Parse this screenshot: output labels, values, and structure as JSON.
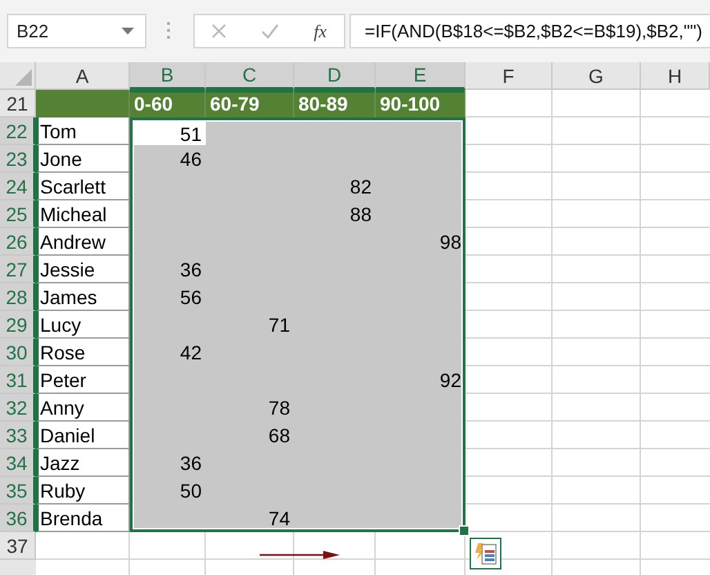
{
  "name_box": {
    "value": "B22"
  },
  "formula_bar": {
    "function_label": "fx",
    "formula": "=IF(AND(B$18<=$B2,$B2<=B$19),$B2,\"\")"
  },
  "columns": [
    {
      "label": "A",
      "selected": false
    },
    {
      "label": "B",
      "selected": true
    },
    {
      "label": "C",
      "selected": true
    },
    {
      "label": "D",
      "selected": true
    },
    {
      "label": "E",
      "selected": true
    },
    {
      "label": "F",
      "selected": false
    },
    {
      "label": "G",
      "selected": false
    },
    {
      "label": "H",
      "selected": false
    }
  ],
  "rows": [
    {
      "label": "21",
      "kind": "header",
      "selected": false,
      "cells": [
        null,
        "0-60",
        "60-79",
        "80-89",
        "90-100"
      ]
    },
    {
      "label": "22",
      "kind": "data",
      "selected": true,
      "cells": [
        "Tom",
        "51",
        null,
        null,
        null
      ]
    },
    {
      "label": "23",
      "kind": "data",
      "selected": true,
      "cells": [
        "Jone",
        "46",
        null,
        null,
        null
      ]
    },
    {
      "label": "24",
      "kind": "data",
      "selected": true,
      "cells": [
        "Scarlett",
        null,
        null,
        "82",
        null
      ]
    },
    {
      "label": "25",
      "kind": "data",
      "selected": true,
      "cells": [
        "Micheal",
        null,
        null,
        "88",
        null
      ]
    },
    {
      "label": "26",
      "kind": "data",
      "selected": true,
      "cells": [
        "Andrew",
        null,
        null,
        null,
        "98"
      ]
    },
    {
      "label": "27",
      "kind": "data",
      "selected": true,
      "cells": [
        "Jessie",
        "36",
        null,
        null,
        null
      ]
    },
    {
      "label": "28",
      "kind": "data",
      "selected": true,
      "cells": [
        "James",
        "56",
        null,
        null,
        null
      ]
    },
    {
      "label": "29",
      "kind": "data",
      "selected": true,
      "cells": [
        "Lucy",
        null,
        "71",
        null,
        null
      ]
    },
    {
      "label": "30",
      "kind": "data",
      "selected": true,
      "cells": [
        "Rose",
        "42",
        null,
        null,
        null
      ]
    },
    {
      "label": "31",
      "kind": "data",
      "selected": true,
      "cells": [
        "Peter",
        null,
        null,
        null,
        "92"
      ]
    },
    {
      "label": "32",
      "kind": "data",
      "selected": true,
      "cells": [
        "Anny",
        null,
        "78",
        null,
        null
      ]
    },
    {
      "label": "33",
      "kind": "data",
      "selected": true,
      "cells": [
        "Daniel",
        null,
        "68",
        null,
        null
      ]
    },
    {
      "label": "34",
      "kind": "data",
      "selected": true,
      "cells": [
        "Jazz",
        "36",
        null,
        null,
        null
      ]
    },
    {
      "label": "35",
      "kind": "data",
      "selected": true,
      "cells": [
        "Ruby",
        "50",
        null,
        null,
        null
      ]
    },
    {
      "label": "36",
      "kind": "data",
      "selected": true,
      "cells": [
        "Brenda",
        null,
        "74",
        null,
        null
      ]
    },
    {
      "label": "37",
      "kind": "blank",
      "selected": false,
      "cells": []
    }
  ]
}
